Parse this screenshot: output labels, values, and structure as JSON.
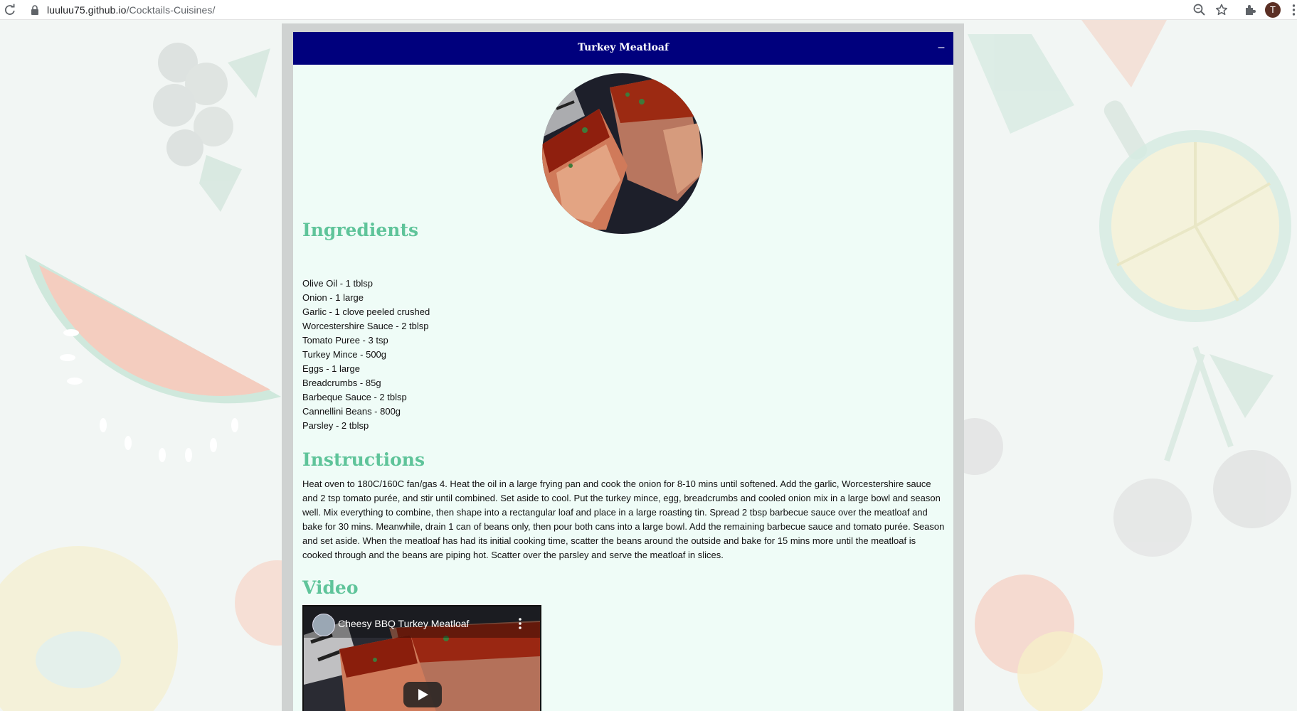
{
  "browser": {
    "url_domain": "luuluu75.github.io",
    "url_path": "/Cocktails-Cuisines/",
    "profile_initial": "T"
  },
  "recipe": {
    "title": "Turkey Meatloaf",
    "collapse_label": "–",
    "ingredients_heading": "Ingredients",
    "ingredients": [
      "Olive Oil - 1 tblsp",
      "Onion - 1 large",
      "Garlic - 1 clove peeled crushed",
      "Worcestershire Sauce - 2 tblsp",
      "Tomato Puree - 3 tsp",
      "Turkey Mince - 500g",
      "Eggs - 1 large",
      "Breadcrumbs - 85g",
      "Barbeque Sauce - 2 tblsp",
      "Cannellini Beans - 800g",
      "Parsley - 2 tblsp"
    ],
    "instructions_heading": "Instructions",
    "instructions": "Heat oven to 180C/160C fan/gas 4. Heat the oil in a large frying pan and cook the onion for 8-10 mins until softened. Add the garlic, Worcestershire sauce and 2 tsp tomato purée, and stir until combined. Set aside to cool. Put the turkey mince, egg, breadcrumbs and cooled onion mix in a large bowl and season well. Mix everything to combine, then shape into a rectangular loaf and place in a large roasting tin. Spread 2 tbsp barbecue sauce over the meatloaf and bake for 30 mins. Meanwhile, drain 1 can of beans only, then pour both cans into a large bowl. Add the remaining barbecue sauce and tomato purée. Season and set aside. When the meatloaf has had its initial cooking time, scatter the beans around the outside and bake for 15 mins more until the meatloaf is cooked through and the beans are piping hot. Scatter over the parsley and serve the meatloaf in slices.",
    "video_heading": "Video",
    "video_title": "Cheesy BBQ Turkey Meatloaf"
  },
  "colors": {
    "header_bg": "#00007d",
    "heading_green": "#5fc49a",
    "card_bg": "#effcf7"
  },
  "icons": [
    "reload-icon",
    "lock-icon",
    "zoom-icon",
    "star-icon",
    "extensions-icon",
    "menu-icon",
    "play-icon"
  ]
}
